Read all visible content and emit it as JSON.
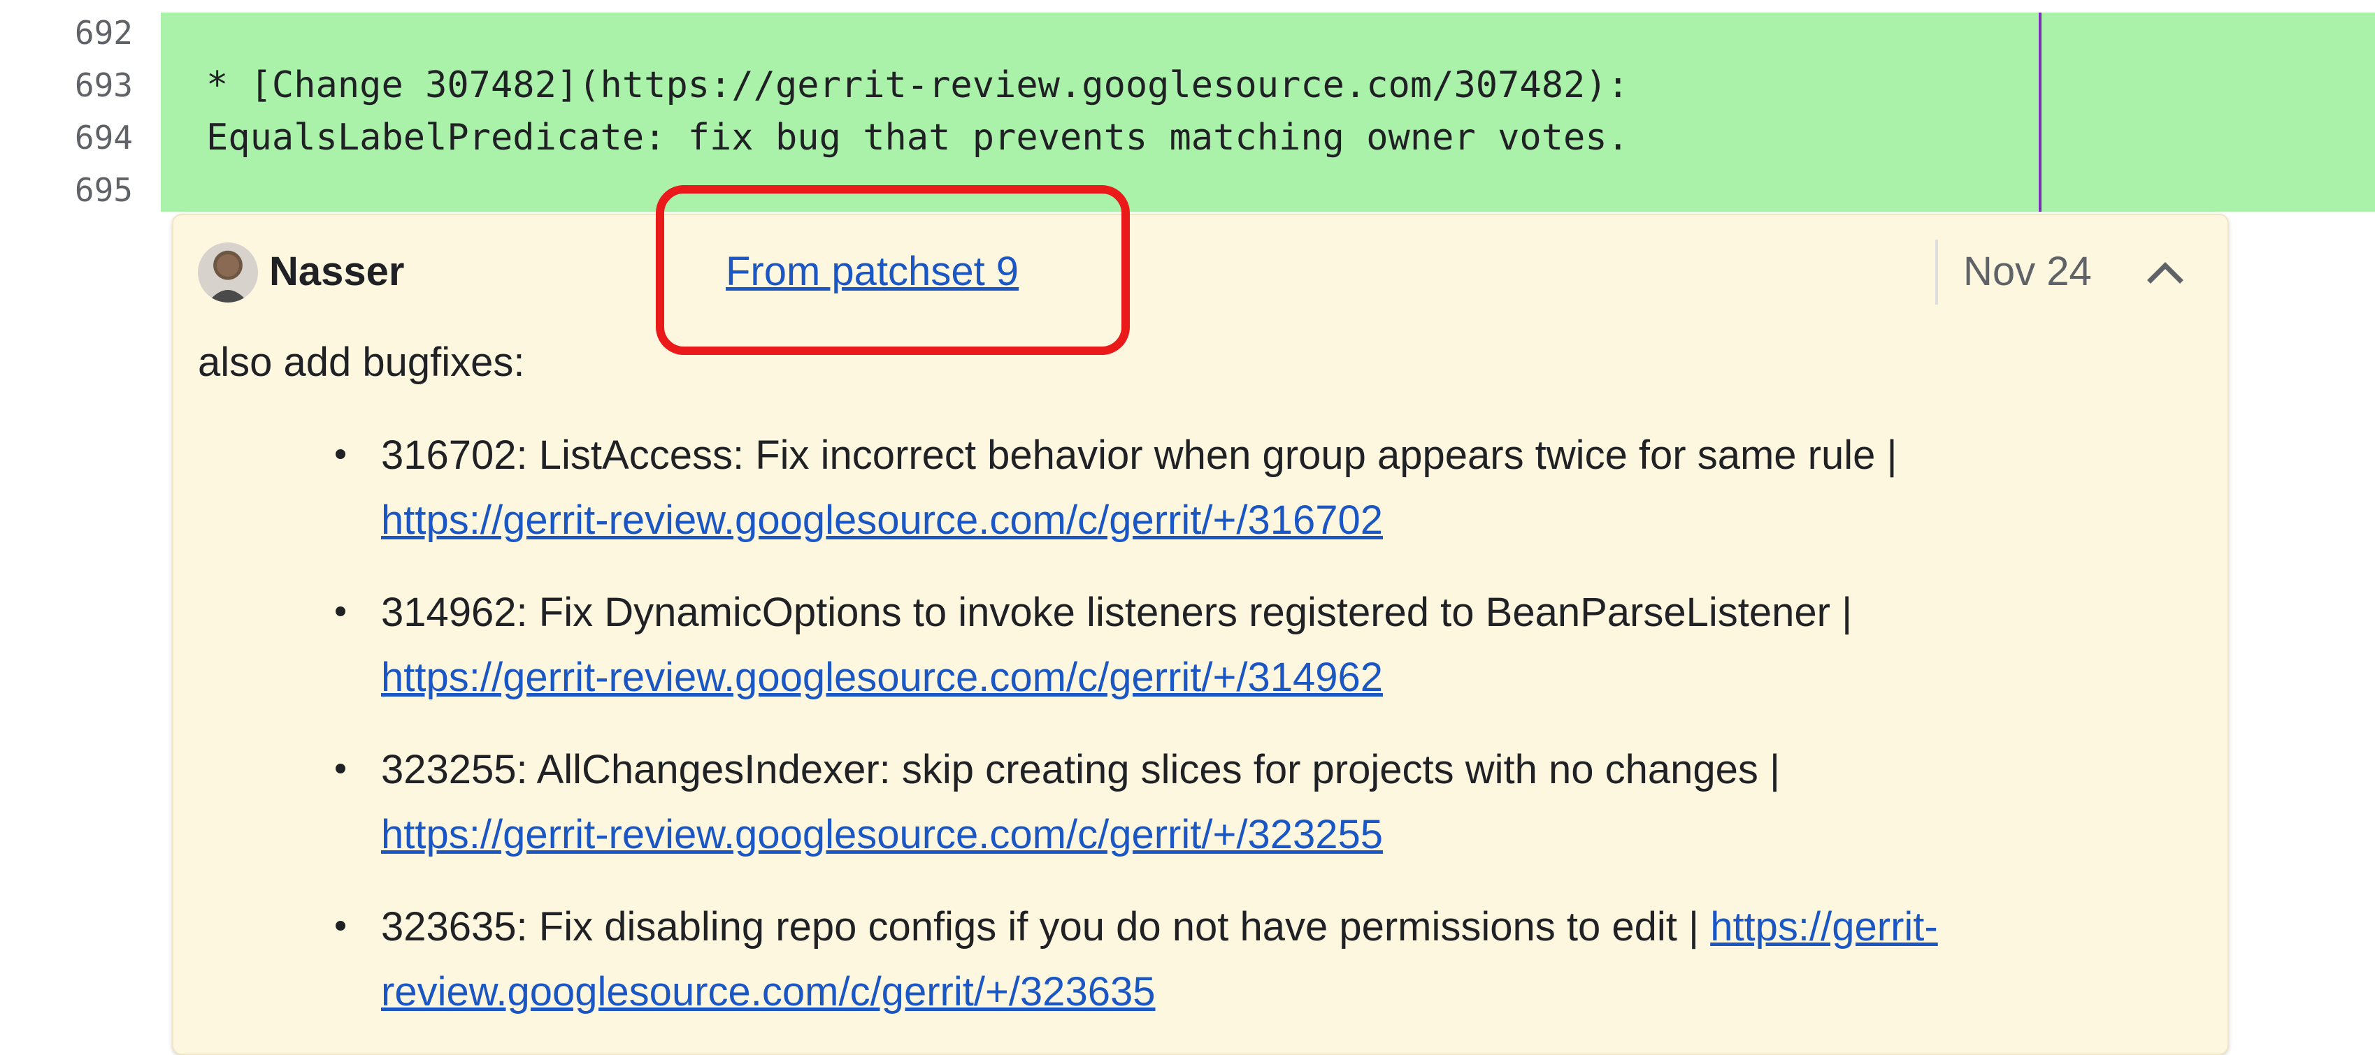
{
  "diff": {
    "line_numbers": [
      "692",
      "693",
      "694",
      "695"
    ],
    "lines": [
      "",
      "* [Change 307482](https://gerrit-review.googlesource.com/307482):",
      "EqualsLabelPredicate: fix bug that prevents matching owner votes.",
      ""
    ]
  },
  "comment": {
    "author": "Nasser",
    "patchset_link": "From patchset 9",
    "date": "Nov 24",
    "message": "also add bugfixes:",
    "bugfixes": [
      {
        "text": "316702: ListAccess: Fix incorrect behavior when group appears twice for same rule |",
        "link1": "https://gerrit-review.googlesource.com/c/gerrit/+/316702",
        "link2": ""
      },
      {
        "text": "314962: Fix DynamicOptions to invoke listeners registered to BeanParseListener |",
        "link1": "https://gerrit-review.googlesource.com/c/gerrit/+/314962",
        "link2": ""
      },
      {
        "text": "323255: AllChangesIndexer: skip creating slices for projects with no changes |",
        "link1": "https://gerrit-review.googlesource.com/c/gerrit/+/323255",
        "link2": ""
      },
      {
        "text": "323635: Fix disabling repo configs if you do not have permissions to edit |",
        "link1": "https://gerrit-",
        "link2": "review.googlesource.com/c/gerrit/+/323635"
      }
    ]
  },
  "colors": {
    "added_line_bg": "#aaf2aa",
    "comment_bg": "#fef7e0",
    "link": "#1a56c4",
    "highlight_box": "#ea1a1a"
  },
  "icons": {
    "collapse": "chevron-up-icon",
    "avatar": "user-avatar"
  }
}
